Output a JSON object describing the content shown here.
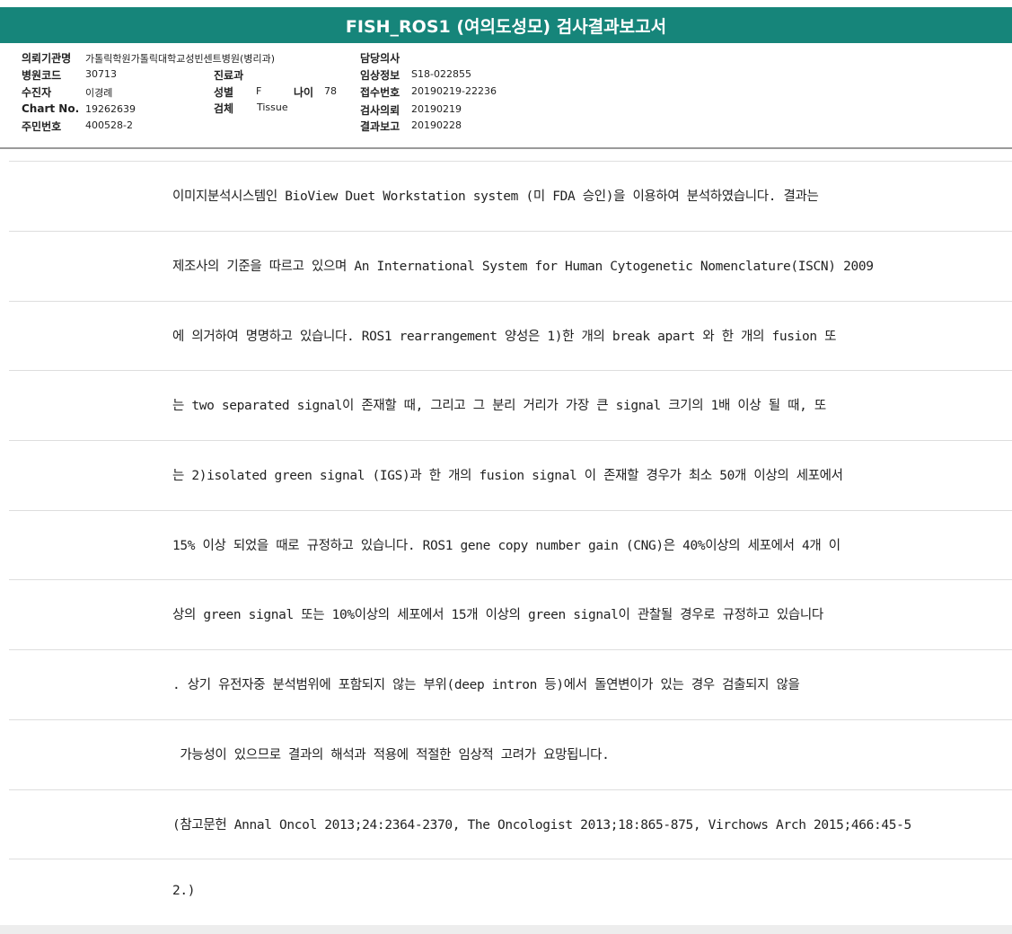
{
  "header": {
    "title": "FISH_ROS1 (여의도성모) 검사결과보고서"
  },
  "info": {
    "institution_label": "의뢰기관명",
    "institution_value": "가톨릭학원가톨릭대학교성빈센트병원(병리과)",
    "hospital_code_label": "병원코드",
    "hospital_code_value": "30713",
    "patient_label": "수진자",
    "patient_value": "이경례",
    "chart_label": "Chart No.",
    "chart_value": "19262639",
    "resident_label": "주민번호",
    "resident_value": "400528-2",
    "dept_label": "진료과",
    "dept_value": "",
    "sex_label": "성별",
    "sex_value": "F",
    "age_label": "나이",
    "age_value": "78",
    "specimen_label": "검체",
    "specimen_value": "Tissue",
    "doctor_label": "담당의사",
    "doctor_value": "",
    "clinical_label": "임상정보",
    "clinical_value": "S18-022855",
    "receipt_label": "접수번호",
    "receipt_value": "20190219-22236",
    "request_label": "검사의뢰",
    "request_value": "20190219",
    "report_label": "결과보고",
    "report_value": "20190228"
  },
  "lines": [
    "이미지분석시스템인 BioView Duet Workstation system (미 FDA 승인)을 이용하여 분석하였습니다. 결과는",
    "제조사의 기준을 따르고 있으며 An International System for Human Cytogenetic Nomenclature(ISCN) 2009",
    "에 의거하여 명명하고 있습니다. ROS1 rearrangement 양성은 1)한 개의 break apart 와 한 개의 fusion 또",
    "는 two separated signal이 존재할 때, 그리고 그 분리 거리가 가장 큰 signal 크기의 1배 이상 될 때, 또",
    "는 2)isolated green signal (IGS)과 한 개의 fusion signal 이 존재할 경우가 최소 50개 이상의 세포에서",
    "15% 이상 되었을 때로 규정하고 있습니다. ROS1 gene copy number gain (CNG)은 40%이상의 세포에서 4개 이",
    "상의 green signal 또는 10%이상의 세포에서 15개 이상의 green signal이 관찰될 경우로 규정하고 있습니다",
    ". 상기 유전자중 분석범위에 포함되지 않는 부위(deep intron 등)에서 돌연변이가 있는 경우 검출되지 않을",
    " 가능성이 있으므로 결과의 해석과 적용에 적절한 임상적 고려가 요망됩니다.",
    "(참고문헌 Annal Oncol 2013;24:2364-2370, The Oncologist 2013;18:865-875, Virchows Arch 2015;466:45-5",
    "2.)"
  ]
}
